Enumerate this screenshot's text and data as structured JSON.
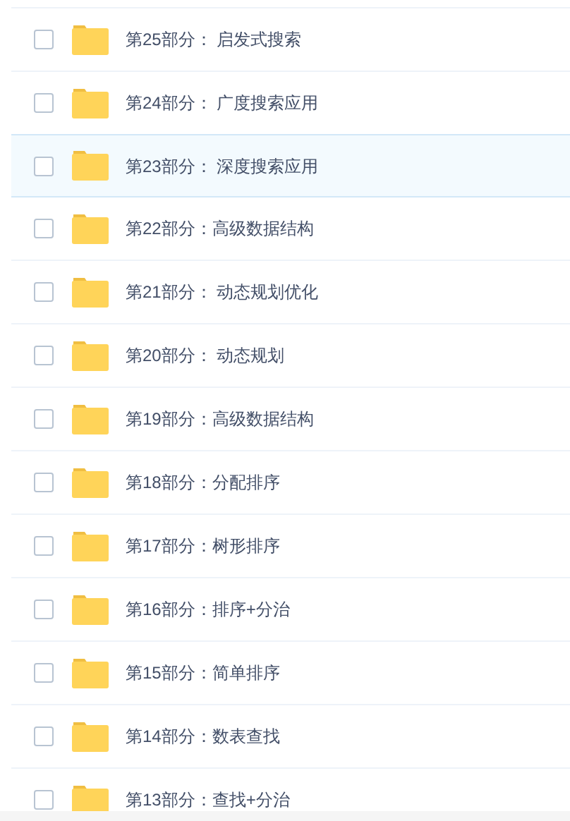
{
  "files": [
    {
      "name": "第25部分： 启发式搜索",
      "checked": false,
      "selected": false
    },
    {
      "name": "第24部分： 广度搜索应用",
      "checked": false,
      "selected": false
    },
    {
      "name": "第23部分： 深度搜索应用",
      "checked": false,
      "selected": true
    },
    {
      "name": "第22部分：高级数据结构",
      "checked": false,
      "selected": false
    },
    {
      "name": "第21部分： 动态规划优化",
      "checked": false,
      "selected": false
    },
    {
      "name": "第20部分： 动态规划",
      "checked": false,
      "selected": false
    },
    {
      "name": "第19部分：高级数据结构",
      "checked": false,
      "selected": false
    },
    {
      "name": "第18部分：分配排序",
      "checked": false,
      "selected": false
    },
    {
      "name": "第17部分：树形排序",
      "checked": false,
      "selected": false
    },
    {
      "name": "第16部分：排序+分治",
      "checked": false,
      "selected": false
    },
    {
      "name": "第15部分：简单排序",
      "checked": false,
      "selected": false
    },
    {
      "name": "第14部分：数表查找",
      "checked": false,
      "selected": false
    },
    {
      "name": "第13部分：查找+分治",
      "checked": false,
      "selected": false
    }
  ]
}
